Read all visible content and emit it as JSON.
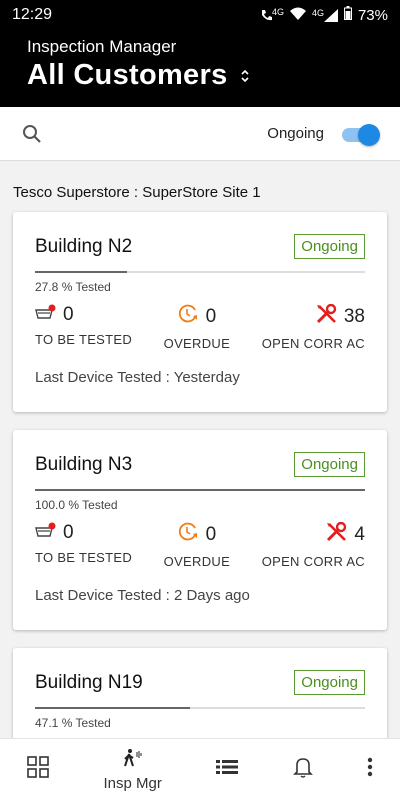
{
  "status": {
    "time": "12:29",
    "network": "4G",
    "network2": "4G",
    "battery": "73%"
  },
  "header": {
    "app_name": "Inspection Manager",
    "title": "All Customers"
  },
  "toolbar": {
    "filter_label": "Ongoing",
    "toggle_on": true
  },
  "site": "Tesco Superstore  : SuperStore Site 1",
  "labels": {
    "to_be_tested": "TO BE TESTED",
    "overdue": "OVERDUE",
    "open_corr": "OPEN CORR AC"
  },
  "buildings": [
    {
      "name": "Building N2",
      "status": "Ongoing",
      "tested_pct": "27.8 % Tested",
      "tested_fraction": 0.278,
      "to_be_tested": "0",
      "overdue": "0",
      "open_corr": "38",
      "last_tested": "Last Device Tested : Yesterday"
    },
    {
      "name": "Building N3",
      "status": "Ongoing",
      "tested_pct": "100.0 % Tested",
      "tested_fraction": 1.0,
      "to_be_tested": "0",
      "overdue": "0",
      "open_corr": "4",
      "last_tested": "Last Device Tested : 2 Days ago"
    },
    {
      "name": "Building N19",
      "status": "Ongoing",
      "tested_pct": "47.1 % Tested",
      "tested_fraction": 0.471,
      "to_be_tested": "",
      "overdue": "",
      "open_corr": "",
      "last_tested": ""
    }
  ],
  "nav": {
    "insp_label": "Insp Mgr"
  },
  "colors": {
    "accent": "#1e88e5",
    "badge_green": "#4a8f1e",
    "icon_orange": "#ef7d1a",
    "icon_red": "#e02020"
  }
}
